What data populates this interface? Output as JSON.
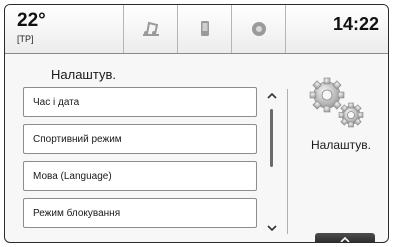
{
  "status": {
    "temperature": "22°",
    "radio_info": "[TP]",
    "time": "14:22"
  },
  "tabs": [
    {
      "icon": "music-note-icon"
    },
    {
      "icon": "phone-icon"
    },
    {
      "icon": "speaker-icon"
    }
  ],
  "page": {
    "title": "Налаштув.",
    "side_label": "Налаштув.",
    "side_icon": "gears-icon"
  },
  "menu": {
    "items": [
      {
        "label": "Час і дата"
      },
      {
        "label": "Спортивний режим"
      },
      {
        "label": "Мова (Language)"
      },
      {
        "label": "Режим блокування"
      }
    ]
  },
  "controls": {
    "scroll_up_icon": "chevron-up-icon",
    "scroll_down_icon": "chevron-down-icon",
    "back_icon": "chevron-up-icon"
  }
}
